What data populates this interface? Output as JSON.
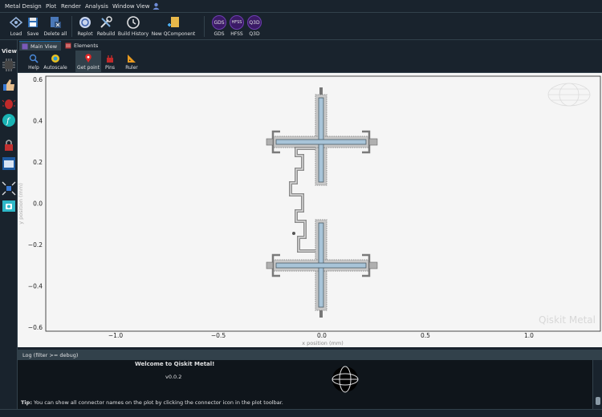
{
  "menubar": {
    "items": [
      "Metal Design",
      "Plot",
      "Render",
      "Analysis",
      "Window View"
    ]
  },
  "toolbar": {
    "buttons": [
      "Load",
      "Save",
      "Delete all",
      "Replot",
      "Rebuild",
      "Build History",
      "New QComponent"
    ],
    "renderers": [
      "GDS",
      "HFSS",
      "Q3D"
    ]
  },
  "sidebar": {
    "title": "View"
  },
  "tabs": [
    "Main View",
    "Elements"
  ],
  "plot_toolbar": {
    "buttons": [
      "Help",
      "Autoscale",
      "Get point",
      "Pins",
      "Ruler"
    ]
  },
  "plot": {
    "xlabel": "x position (mm)",
    "ylabel": "y position (mm)",
    "x_ticks": [
      "−1.0",
      "−0.5",
      "0.0",
      "0.5",
      "1.0"
    ],
    "y_ticks": [
      "0.6",
      "0.4",
      "0.2",
      "0.0",
      "−0.2",
      "−0.4",
      "−0.6"
    ],
    "watermark": "Qiskit Metal"
  },
  "log": {
    "header": "Log  (filter >= debug)",
    "welcome": "Welcome to Qiskit Metal!",
    "version": "v0.0.2",
    "tip_label": "Tip:",
    "tip_text": "You can show all connector names on the plot by clicking the connector icon in the plot toolbar."
  },
  "colors": {
    "background": "#19232d",
    "border": "#32414b",
    "accent": "#1464a0",
    "plot_bg": "#f5f5f5",
    "metal_fill": "#c8d6e0",
    "metal_outline": "#6e7f8c",
    "qubit_inner": "#a8c4d8",
    "renderer_purple": "#3b1a66"
  },
  "icons": [
    "load-icon",
    "save-icon",
    "delete-all-icon",
    "replot-icon",
    "rebuild-icon",
    "build-history-icon",
    "new-qcomponent-icon",
    "help-icon",
    "autoscale-icon",
    "get-point-icon",
    "pins-icon",
    "ruler-icon"
  ]
}
